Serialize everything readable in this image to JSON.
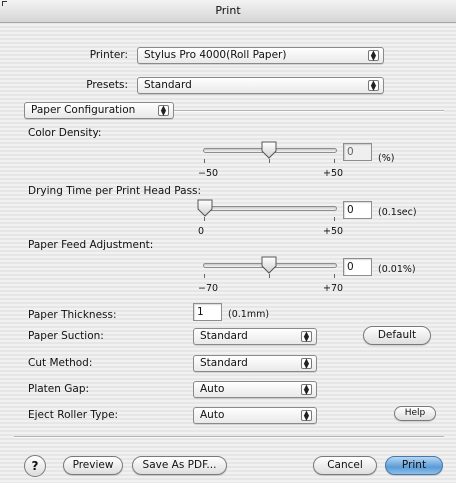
{
  "window": {
    "title": "Print"
  },
  "printer": {
    "label": "Printer:",
    "value": "Stylus Pro 4000(Roll Paper)"
  },
  "presets": {
    "label": "Presets:",
    "value": "Standard"
  },
  "section": {
    "value": "Paper Configuration"
  },
  "color_density": {
    "label": "Color Density:",
    "min": "−50",
    "max": "+50",
    "value": "0",
    "unit": "(%)",
    "position": 0.5
  },
  "drying_time": {
    "label": "Drying Time per Print Head Pass:",
    "min": "0",
    "max": "+50",
    "value": "0",
    "unit": "(0.1sec)",
    "position": 0.0
  },
  "paper_feed": {
    "label": "Paper Feed Adjustment:",
    "min": "−70",
    "max": "+70",
    "value": "0",
    "unit": "(0.01%)",
    "position": 0.5
  },
  "paper_thickness": {
    "label": "Paper Thickness:",
    "value": "1",
    "unit": "(0.1mm)"
  },
  "paper_suction": {
    "label": "Paper Suction:",
    "value": "Standard"
  },
  "cut_method": {
    "label": "Cut Method:",
    "value": "Standard"
  },
  "platen_gap": {
    "label": "Platen Gap:",
    "value": "Auto"
  },
  "eject_roller": {
    "label": "Eject Roller Type:",
    "value": "Auto"
  },
  "buttons": {
    "default": "Default",
    "help_small": "Help",
    "help_icon": "?",
    "preview": "Preview",
    "save_pdf": "Save As PDF...",
    "cancel": "Cancel",
    "print": "Print"
  },
  "icons": {
    "popup_arrows": "updown-arrows-icon",
    "slider_thumb": "slider-thumb-icon",
    "help": "question-mark-icon"
  },
  "colors": {
    "default_button": "#5b9bd6"
  }
}
